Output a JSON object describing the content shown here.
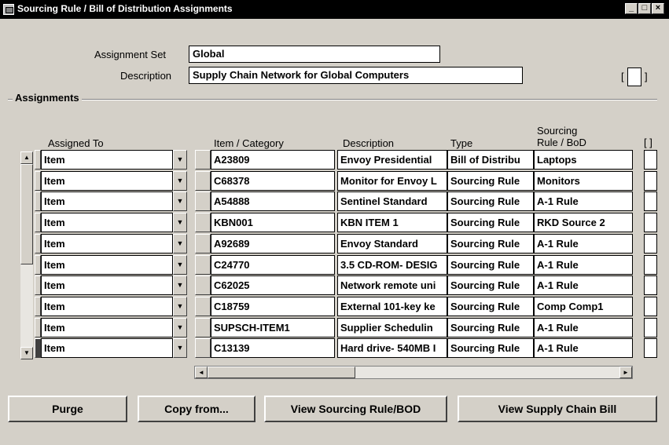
{
  "window": {
    "title": "Sourcing Rule / Bill of Distribution Assignments",
    "minimize": "_",
    "maximize": "□",
    "close": "×"
  },
  "form": {
    "assignment_set_label": "Assignment Set",
    "assignment_set_value": "Global",
    "description_label": "Description",
    "description_value": "Supply Chain Network for Global Computers",
    "flex_open": "[",
    "flex_close": "]"
  },
  "assignments": {
    "section_title": "Assignments",
    "columns": {
      "assigned_to": "Assigned To",
      "item_category": "Item / Category",
      "description": "Description",
      "type": "Type",
      "sourcing_line1": "Sourcing",
      "sourcing_line2": "Rule / BoD",
      "flex": "[ ]"
    },
    "rows": [
      {
        "assigned_to": "Item",
        "item": "A23809",
        "description": "Envoy Presidential",
        "type": "Bill of Distribu",
        "sourcing": "Laptops"
      },
      {
        "assigned_to": "Item",
        "item": "C68378",
        "description": "Monitor for Envoy L",
        "type": "Sourcing Rule",
        "sourcing": "Monitors"
      },
      {
        "assigned_to": "Item",
        "item": "A54888",
        "description": "Sentinel Standard",
        "type": "Sourcing Rule",
        "sourcing": "A-1 Rule"
      },
      {
        "assigned_to": "Item",
        "item": "KBN001",
        "description": "KBN ITEM 1",
        "type": "Sourcing Rule",
        "sourcing": "RKD Source 2"
      },
      {
        "assigned_to": "Item",
        "item": "A92689",
        "description": "Envoy Standard",
        "type": "Sourcing Rule",
        "sourcing": "A-1 Rule"
      },
      {
        "assigned_to": "Item",
        "item": "C24770",
        "description": "3.5 CD-ROM- DESIG",
        "type": "Sourcing Rule",
        "sourcing": "A-1 Rule"
      },
      {
        "assigned_to": "Item",
        "item": "C62025",
        "description": "Network remote uni",
        "type": "Sourcing Rule",
        "sourcing": "A-1 Rule"
      },
      {
        "assigned_to": "Item",
        "item": "C18759",
        "description": "External 101-key ke",
        "type": "Sourcing Rule",
        "sourcing": "Comp Comp1"
      },
      {
        "assigned_to": "Item",
        "item": "SUPSCH-ITEM1",
        "description": "Supplier Schedulin",
        "type": "Sourcing Rule",
        "sourcing": "A-1 Rule"
      },
      {
        "assigned_to": "Item",
        "item": "C13139",
        "description": "Hard drive- 540MB I",
        "type": "Sourcing Rule",
        "sourcing": "A-1 Rule"
      }
    ]
  },
  "buttons": {
    "purge": "Purge",
    "copy_from": "Copy from...",
    "view_sourcing_rule": "View Sourcing Rule/BOD",
    "view_supply_chain_bill": "View Supply Chain Bill"
  },
  "icons": {
    "window_icon": "window-icon",
    "dropdown": "chevron-down-icon",
    "scroll_up": "arrow-up-icon",
    "scroll_down": "arrow-down-icon",
    "scroll_left": "arrow-left-icon",
    "scroll_right": "arrow-right-icon"
  },
  "colors": {
    "background": "#d4d0c8",
    "titlebar": "#000000",
    "field": "#ffffff"
  }
}
